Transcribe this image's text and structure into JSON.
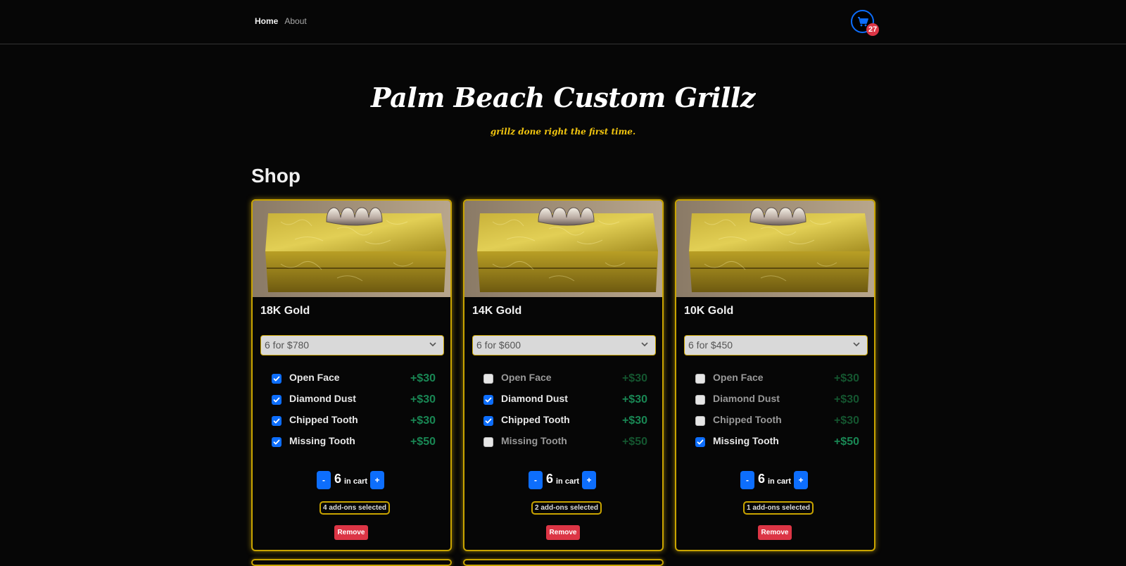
{
  "nav": {
    "links": [
      {
        "label": "Home",
        "active": true
      },
      {
        "label": "About",
        "active": false
      }
    ],
    "cart_count": "27",
    "cart_icon": "cart-icon"
  },
  "hero": {
    "title": "Palm Beach Custom Grillz",
    "tagline": "grillz done right the first time."
  },
  "shop": {
    "heading": "Shop",
    "products": [
      {
        "title": "18K Gold",
        "selected_option": "6 for $780",
        "addons": [
          {
            "label": "Open Face",
            "price": "+$30",
            "checked": true
          },
          {
            "label": "Diamond Dust",
            "price": "+$30",
            "checked": true
          },
          {
            "label": "Chipped Tooth",
            "price": "+$30",
            "checked": true
          },
          {
            "label": "Missing Tooth",
            "price": "+$50",
            "checked": true
          }
        ],
        "decrement_label": "-",
        "increment_label": "+",
        "quantity": "6",
        "quantity_label": "in cart",
        "addons_summary": "4 add-ons selected",
        "remove_label": "Remove"
      },
      {
        "title": "14K Gold",
        "selected_option": "6 for $600",
        "addons": [
          {
            "label": "Open Face",
            "price": "+$30",
            "checked": false
          },
          {
            "label": "Diamond Dust",
            "price": "+$30",
            "checked": true
          },
          {
            "label": "Chipped Tooth",
            "price": "+$30",
            "checked": true
          },
          {
            "label": "Missing Tooth",
            "price": "+$50",
            "checked": false
          }
        ],
        "decrement_label": "-",
        "increment_label": "+",
        "quantity": "6",
        "quantity_label": "in cart",
        "addons_summary": "2 add-ons selected",
        "remove_label": "Remove"
      },
      {
        "title": "10K Gold",
        "selected_option": "6 for $450",
        "addons": [
          {
            "label": "Open Face",
            "price": "+$30",
            "checked": false
          },
          {
            "label": "Diamond Dust",
            "price": "+$30",
            "checked": false
          },
          {
            "label": "Chipped Tooth",
            "price": "+$30",
            "checked": false
          },
          {
            "label": "Missing Tooth",
            "price": "+$50",
            "checked": true
          }
        ],
        "decrement_label": "-",
        "increment_label": "+",
        "quantity": "6",
        "quantity_label": "in cart",
        "addons_summary": "1 add-ons selected",
        "remove_label": "Remove"
      }
    ]
  },
  "colors": {
    "accent_gold": "#f0c40f",
    "primary_blue": "#0d6efd",
    "danger_red": "#dc3545",
    "price_green": "#198754"
  }
}
